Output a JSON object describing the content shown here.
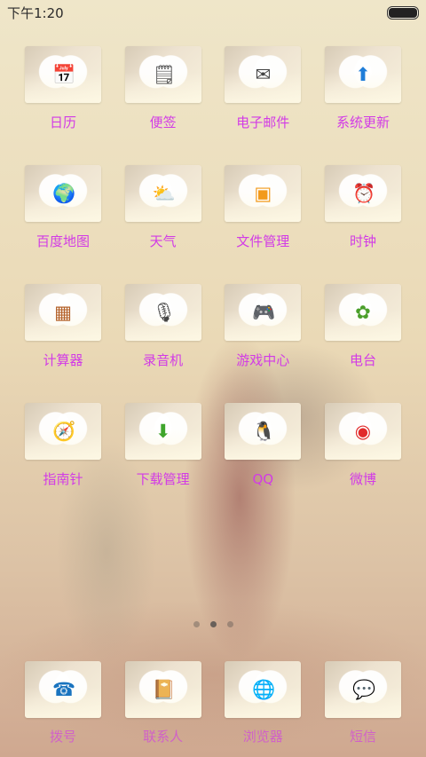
{
  "status_bar": {
    "time": "下午1:20",
    "battery_level": 1.0
  },
  "apps": [
    {
      "label": "日历",
      "icon": "calendar-icon",
      "glyph": "📅"
    },
    {
      "label": "便签",
      "icon": "sticky-note-icon",
      "glyph": "🗒"
    },
    {
      "label": "电子邮件",
      "icon": "mail-icon",
      "glyph": "✉"
    },
    {
      "label": "系统更新",
      "icon": "update-arrow-icon",
      "glyph": "⬆",
      "color": "#1f7dd8"
    },
    {
      "label": "百度地图",
      "icon": "map-globe-icon",
      "glyph": "🌍"
    },
    {
      "label": "天气",
      "icon": "weather-icon",
      "glyph": "⛅"
    },
    {
      "label": "文件管理",
      "icon": "folder-icon",
      "glyph": "▣",
      "color": "#f29a1c"
    },
    {
      "label": "时钟",
      "icon": "clock-icon",
      "glyph": "⏰"
    },
    {
      "label": "计算器",
      "icon": "calculator-icon",
      "glyph": "▦",
      "color": "#b4622a"
    },
    {
      "label": "录音机",
      "icon": "recorder-icon",
      "glyph": "🎙"
    },
    {
      "label": "游戏中心",
      "icon": "game-center-icon",
      "glyph": "🎮"
    },
    {
      "label": "电台",
      "icon": "radio-icon",
      "glyph": "✿",
      "color": "#4b9f2b"
    },
    {
      "label": "指南针",
      "icon": "compass-icon",
      "glyph": "🧭"
    },
    {
      "label": "下载管理",
      "icon": "download-icon",
      "glyph": "⬇",
      "color": "#3fa52c"
    },
    {
      "label": "QQ",
      "icon": "qq-penguin-icon",
      "glyph": "🐧"
    },
    {
      "label": "微博",
      "icon": "weibo-icon",
      "glyph": "◉",
      "color": "#e12b2b"
    }
  ],
  "page_indicator": {
    "count": 3,
    "active": 1
  },
  "dock": [
    {
      "label": "拨号",
      "icon": "phone-icon",
      "glyph": "☎",
      "color": "#1a74bf"
    },
    {
      "label": "联系人",
      "icon": "contacts-book-icon",
      "glyph": "📔"
    },
    {
      "label": "浏览器",
      "icon": "browser-icon",
      "glyph": "🌐"
    },
    {
      "label": "短信",
      "icon": "message-icon",
      "glyph": "💬"
    }
  ]
}
